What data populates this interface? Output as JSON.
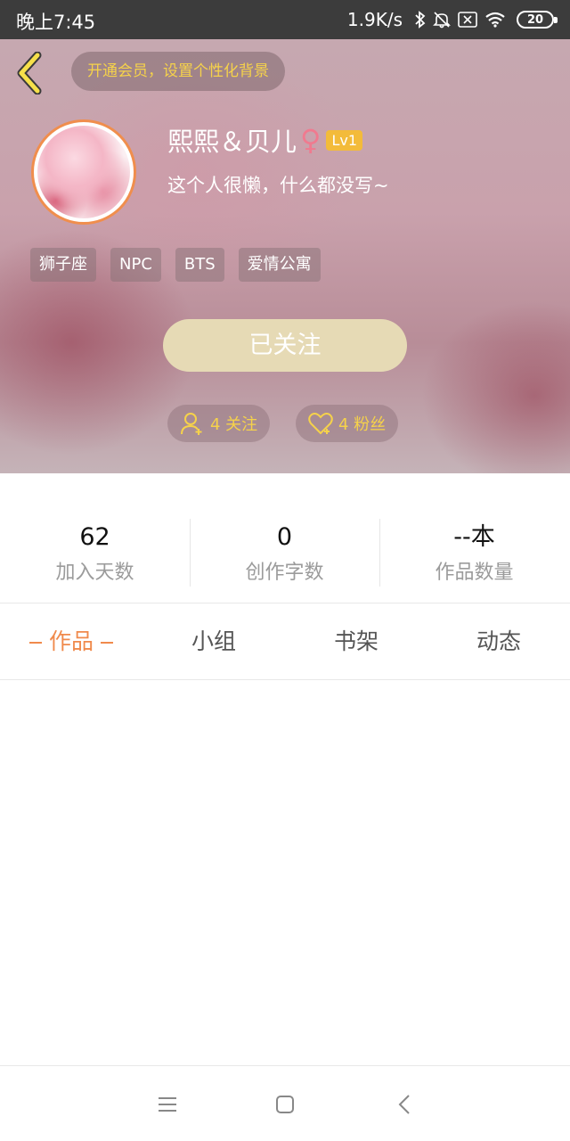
{
  "status_bar": {
    "time": "晚上7:45",
    "net_speed": "1.9K/s",
    "battery": "20",
    "icons": [
      "bluetooth-icon",
      "mute-icon",
      "sim-off-icon",
      "wifi-icon",
      "battery-icon"
    ]
  },
  "header": {
    "vip_prompt": "开通会员，设置个性化背景",
    "username": "熙熙＆贝儿",
    "gender_symbol": "♀",
    "level": "Lv1",
    "bio": "这个人很懒，什么都没写~",
    "tags": [
      "狮子座",
      "NPC",
      "BTS",
      "爱情公寓"
    ],
    "follow_button": "已关注",
    "following_count": "4 关注",
    "fans_count": "4 粉丝"
  },
  "stats": [
    {
      "value": "62",
      "label": "加入天数"
    },
    {
      "value": "0",
      "label": "创作字数"
    },
    {
      "value": "--本",
      "label": "作品数量"
    }
  ],
  "tabs": [
    {
      "label": "作品",
      "active": true
    },
    {
      "label": "小组",
      "active": false
    },
    {
      "label": "书架",
      "active": false
    },
    {
      "label": "动态",
      "active": false
    }
  ],
  "colors": {
    "accent": "#f08a4c",
    "yellow": "#f6d24a",
    "follow_button_bg": "#e6dab5",
    "level_badge": "#f3bb3a"
  }
}
